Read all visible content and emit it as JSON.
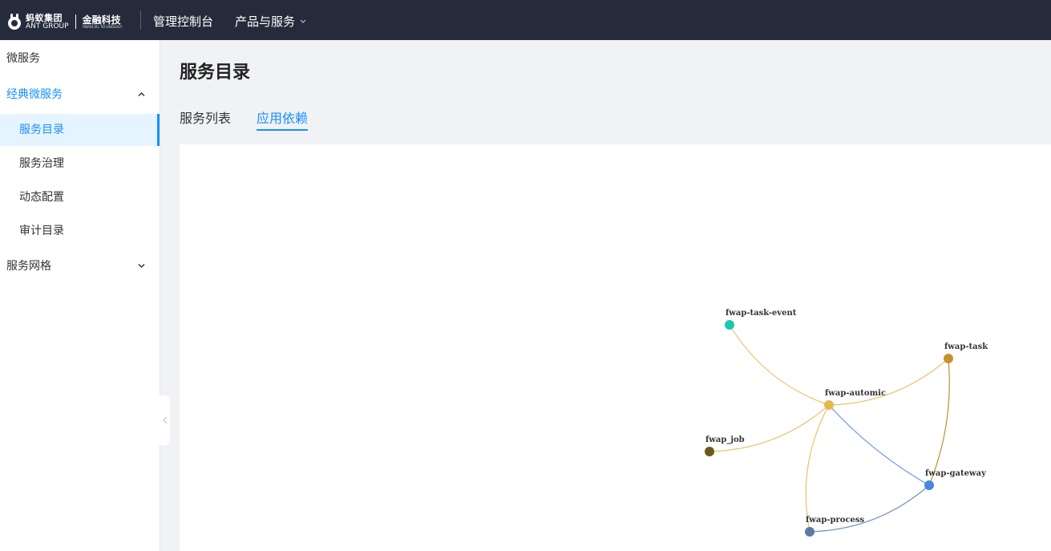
{
  "header": {
    "logo_cn": "蚂蚁集团",
    "logo_en": "ANT GROUP",
    "logo_fin_cn": "金融科技",
    "logo_fin_en": "FINANCIAL TECHNOLOGY",
    "console_label": "管理控制台",
    "products_label": "产品与服务"
  },
  "sidebar": {
    "top_item": "微服务",
    "classic": {
      "label": "经典微服务",
      "items": [
        {
          "label": "服务目录",
          "active": true
        },
        {
          "label": "服务治理",
          "active": false
        },
        {
          "label": "动态配置",
          "active": false
        },
        {
          "label": "审计目录",
          "active": false
        }
      ]
    },
    "mesh": {
      "label": "服务网格"
    }
  },
  "main": {
    "title": "服务目录",
    "tabs": [
      {
        "label": "服务列表",
        "active": false
      },
      {
        "label": "应用依赖",
        "active": true
      }
    ]
  },
  "graph": {
    "nodes": [
      {
        "id": "fwap-task-event",
        "label": "fwap-task-event",
        "color": "#1cc7b1"
      },
      {
        "id": "fwap-task",
        "label": "fwap-task",
        "color": "#c8922a"
      },
      {
        "id": "fwap-automic",
        "label": "fwap-automic",
        "color": "#e6b74a"
      },
      {
        "id": "fwap_job",
        "label": "fwap_job",
        "color": "#6b5a1e"
      },
      {
        "id": "fwap-gateway",
        "label": "fwap-gateway",
        "color": "#4a86e0"
      },
      {
        "id": "fwap-process",
        "label": "fwap-process",
        "color": "#5b7aa8"
      }
    ],
    "edges": [
      {
        "source": "fwap-task-event",
        "target": "fwap-automic",
        "color": "#e6c36a"
      },
      {
        "source": "fwap-automic",
        "target": "fwap-task",
        "color": "#e6c36a"
      },
      {
        "source": "fwap_job",
        "target": "fwap-automic",
        "color": "#e6c36a"
      },
      {
        "source": "fwap-automic",
        "target": "fwap-process",
        "color": "#e6c36a"
      },
      {
        "source": "fwap-automic",
        "target": "fwap-gateway",
        "color": "#6f9be0"
      },
      {
        "source": "fwap-task",
        "target": "fwap-gateway",
        "color": "#b8942e"
      },
      {
        "source": "fwap-process",
        "target": "fwap-gateway",
        "color": "#6f8fb8"
      }
    ]
  }
}
